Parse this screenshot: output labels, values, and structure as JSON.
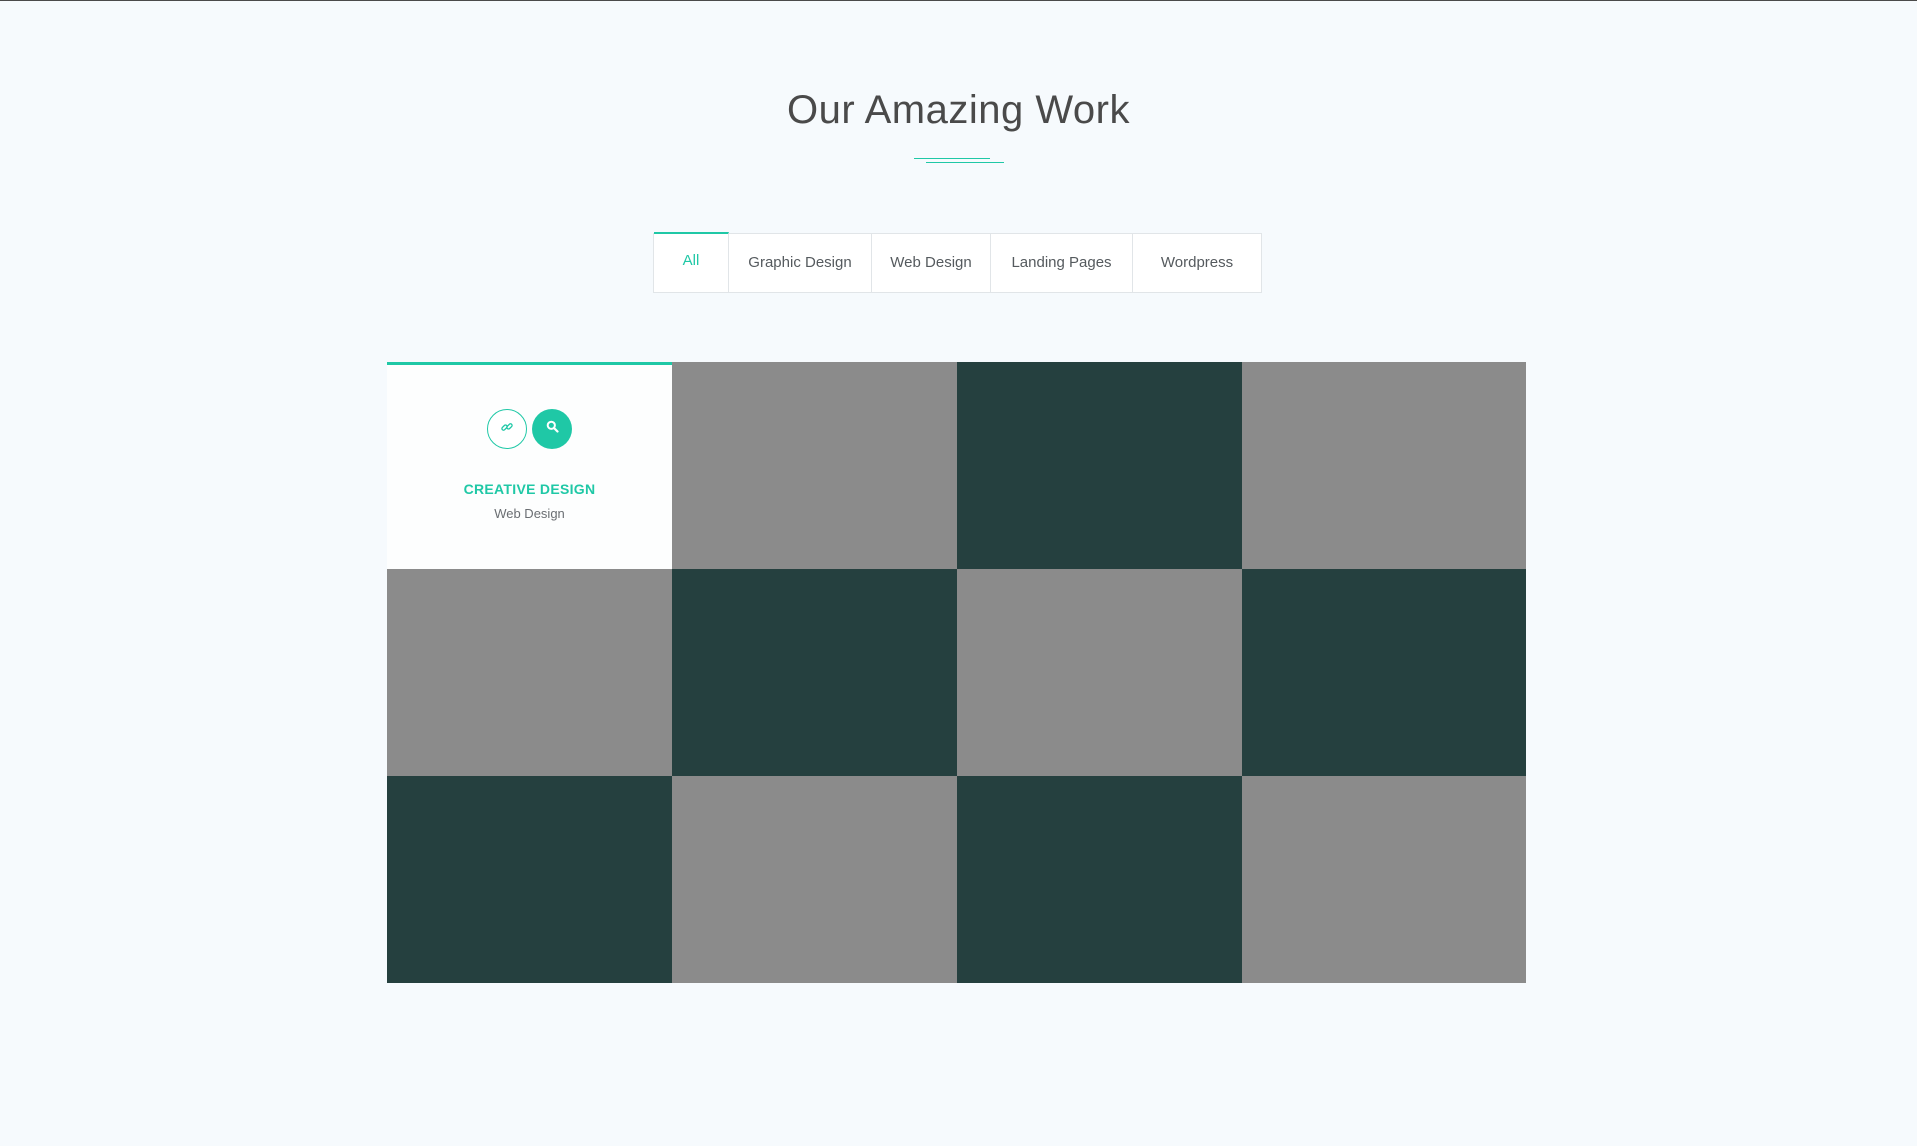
{
  "section": {
    "title": "Our Amazing Work"
  },
  "filters": [
    {
      "label": "All",
      "active": true
    },
    {
      "label": "Graphic Design",
      "active": false
    },
    {
      "label": "Web Design",
      "active": false
    },
    {
      "label": "Landing Pages",
      "active": false
    },
    {
      "label": "Wordpress",
      "active": false
    }
  ],
  "portfolio": {
    "featured": {
      "title": "CREATIVE DESIGN",
      "category": "Web Design",
      "link_icon": "link-icon",
      "zoom_icon": "search-icon"
    },
    "tiles": [
      "featured",
      "gray",
      "dark",
      "gray",
      "gray",
      "dark",
      "gray",
      "dark",
      "dark",
      "gray",
      "dark",
      "gray"
    ]
  },
  "colors": {
    "accent": "#1fc8a6",
    "background": "#f6fafd",
    "tile_gray": "#8b8b8b",
    "tile_dark": "#25403f",
    "title_text": "#4a4a4a"
  }
}
